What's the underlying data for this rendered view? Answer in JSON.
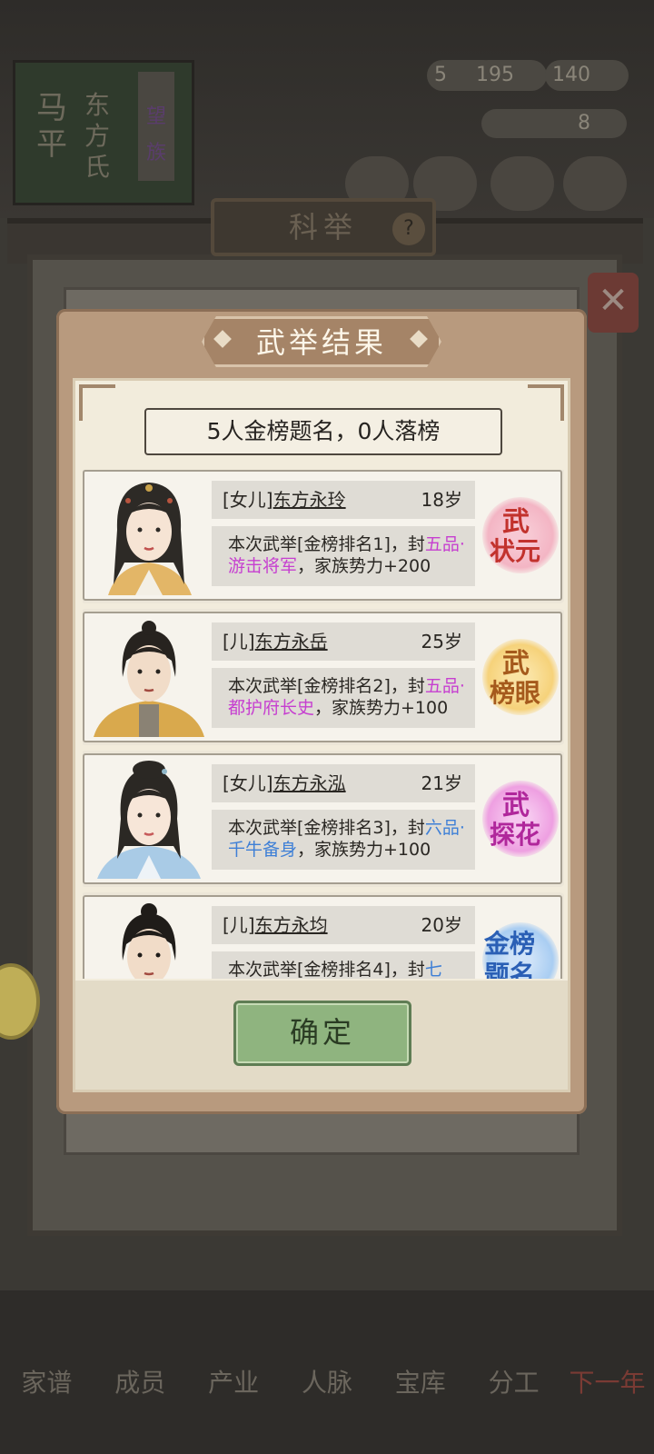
{
  "background": {
    "family_book": {
      "clan": "马平",
      "surname": "东方氏",
      "tag": "望族"
    },
    "resources": {
      "r1": "5",
      "r2": "195",
      "r3": "140",
      "r4": "8"
    },
    "screen_title": "科举",
    "help": "?",
    "nav": [
      "家谱",
      "成员",
      "产业",
      "人脉",
      "宝库",
      "分工",
      "下一年"
    ]
  },
  "modal": {
    "title": "武举结果",
    "summary": "5人金榜题名，0人落榜",
    "results": [
      {
        "relation": "[女儿]",
        "name": "东方永玲",
        "age": "18岁",
        "desc_prefix": "本次武举[金榜排名1]，封",
        "rank": "五品·游击将军",
        "desc_suffix": "，家族势力+200",
        "rank_color": "#c63fd0",
        "title_lines": [
          "武",
          "状元"
        ],
        "seal_color": "pink"
      },
      {
        "relation": "[儿]",
        "name": "东方永岳",
        "age": "25岁",
        "desc_prefix": "本次武举[金榜排名2]，封",
        "rank": "五品·都护府长史",
        "desc_suffix": "，家族势力+100",
        "rank_color": "#c63fd0",
        "title_lines": [
          "武",
          "榜眼"
        ],
        "seal_color": "gold"
      },
      {
        "relation": "[女儿]",
        "name": "东方永泓",
        "age": "21岁",
        "desc_prefix": "本次武举[金榜排名3]，封",
        "rank": "六品·千牛备身",
        "desc_suffix": "，家族势力+100",
        "rank_color": "#3e7fd6",
        "title_lines": [
          "武",
          "探花"
        ],
        "seal_color": "magenta"
      },
      {
        "relation": "[儿]",
        "name": "东方永均",
        "age": "20岁",
        "desc_prefix": "本次武举[金榜排名4]，封",
        "rank": "七",
        "desc_suffix": "",
        "rank_color": "#3e7fd6",
        "title_lines": [
          "金榜",
          "题名"
        ],
        "seal_color": "blue"
      }
    ],
    "confirm_label": "确定"
  }
}
